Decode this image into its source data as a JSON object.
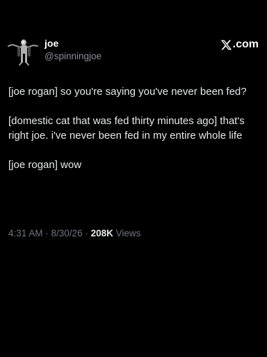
{
  "author": {
    "display_name": "joe",
    "handle": "@spinningjoe",
    "avatar_icon": "avatar-dancing-figure-icon"
  },
  "brand": {
    "label": ".com",
    "icon": "x-logo-icon"
  },
  "tweet": {
    "paragraphs": [
      "[joe rogan] so you're saying you've never been fed?",
      "[domestic cat that was fed thirty minutes ago] that's right joe. i've never been fed in my entire whole life",
      "[joe rogan] wow"
    ]
  },
  "meta": {
    "time": "4:31 AM",
    "separator": " · ",
    "date": "8/30/26",
    "views_count": "208K",
    "views_label": " Views"
  },
  "colors": {
    "background": "#000000",
    "text": "#e7e9ea",
    "muted": "#71767b"
  }
}
